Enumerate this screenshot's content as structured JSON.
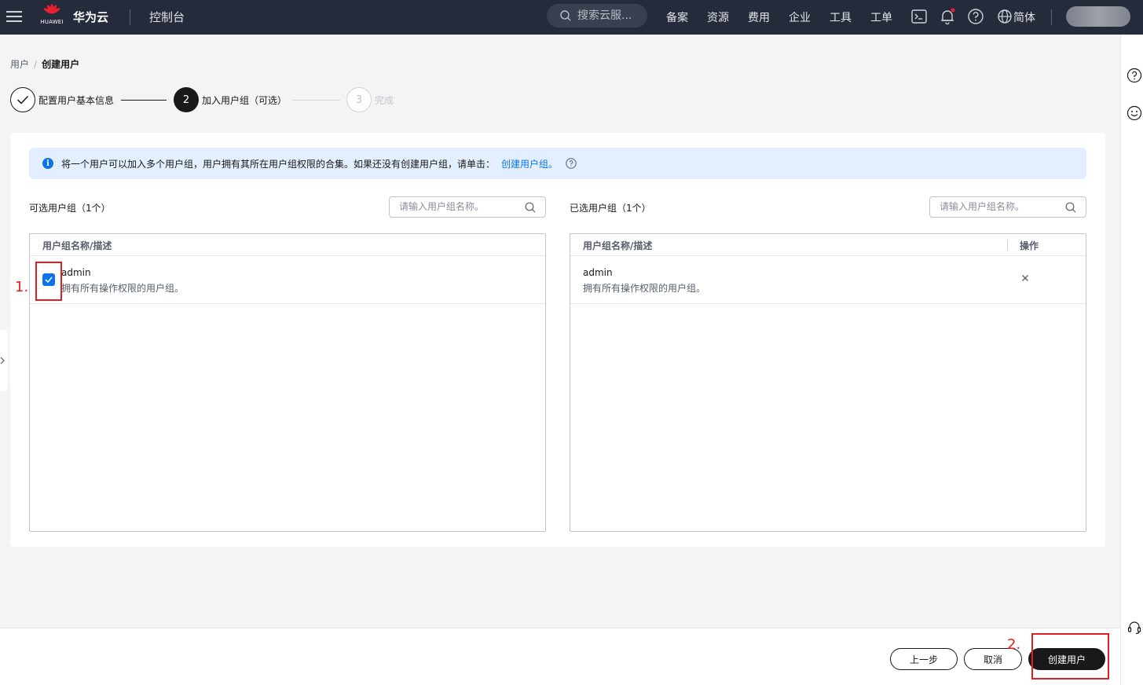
{
  "topbar": {
    "logo_text": "HUAWEI",
    "brand": "华为云",
    "console": "控制台",
    "search_placeholder": "搜索云服...",
    "nav": [
      "备案",
      "资源",
      "费用",
      "企业",
      "工具",
      "工单"
    ],
    "language": "简体",
    "icons": [
      "menu-icon",
      "huawei-logo",
      "search-icon",
      "terminal-icon",
      "bell-icon",
      "help-icon",
      "globe-icon"
    ]
  },
  "breadcrumb": {
    "parent": "用户",
    "separator": "/",
    "current": "创建用户"
  },
  "steps": [
    {
      "index": "1",
      "label": "配置用户基本信息",
      "state": "done"
    },
    {
      "index": "2",
      "label": "加入用户组（可选）",
      "state": "active"
    },
    {
      "index": "3",
      "label": "完成",
      "state": "pending"
    }
  ],
  "info": {
    "text": "将一个用户可以加入多个用户组，用户拥有其所在用户组权限的合集。如果还没有创建用户组，请单击：",
    "link": "创建用户组。"
  },
  "available": {
    "title": "可选用户组（1个）",
    "search_placeholder": "请输入用户组名称。",
    "header": "用户组名称/描述",
    "rows": [
      {
        "name": "admin",
        "desc": "拥有所有操作权限的用户组。",
        "checked": true
      }
    ]
  },
  "selected": {
    "title": "已选用户组（1个）",
    "search_placeholder": "请输入用户组名称。",
    "header": "用户组名称/描述",
    "op_header": "操作",
    "rows": [
      {
        "name": "admin",
        "desc": "拥有所有操作权限的用户组。"
      }
    ]
  },
  "annotations": {
    "one": "1.",
    "two": "2."
  },
  "footer": {
    "prev": "上一步",
    "cancel": "取消",
    "create": "创建用户"
  },
  "colors": {
    "accent": "#0d74e7",
    "topbar": "#252b3a",
    "annotation": "#e02020",
    "primary_button": "#191919",
    "notice_bg": "#e3eeff"
  }
}
